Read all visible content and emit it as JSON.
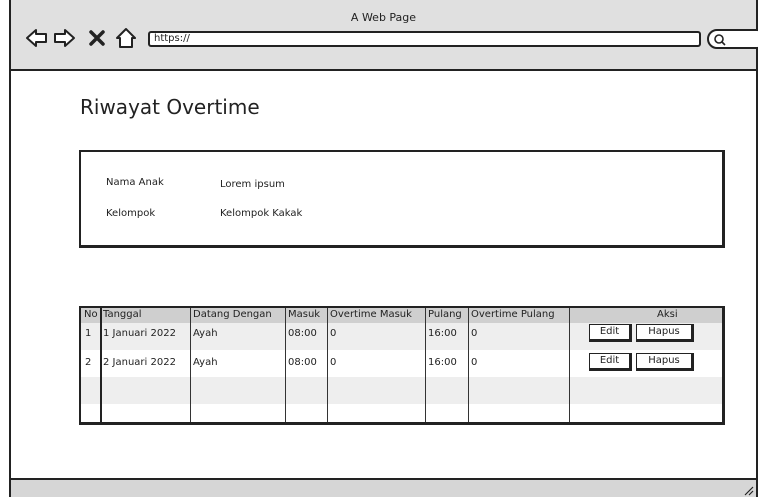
{
  "browser": {
    "window_title": "A Web Page",
    "url": "https://",
    "icons": [
      "back-arrow-icon",
      "forward-arrow-icon",
      "close-icon",
      "home-icon",
      "search-icon"
    ]
  },
  "page": {
    "title": "Riwayat Overtime"
  },
  "info": {
    "name_label": "Nama Anak",
    "name_value": "Lorem ipsum",
    "group_label": "Kelompok",
    "group_value": "Kelompok Kakak"
  },
  "table": {
    "columns": [
      "No",
      "Tanggal",
      "Datang Dengan",
      "Masuk",
      "Overtime Masuk",
      "Pulang",
      "Overtime Pulang",
      "Aksi"
    ],
    "rows": [
      {
        "no": "1",
        "tanggal": "1 Januari 2022",
        "datang": "Ayah",
        "masuk": "08:00",
        "ot_masuk": "0",
        "pulang": "16:00",
        "ot_pulang": "0"
      },
      {
        "no": "2",
        "tanggal": "2 Januari 2022",
        "datang": "Ayah",
        "masuk": "08:00",
        "ot_masuk": "0",
        "pulang": "16:00",
        "ot_pulang": "0"
      }
    ],
    "actions": {
      "edit": "Edit",
      "delete": "Hapus"
    }
  }
}
